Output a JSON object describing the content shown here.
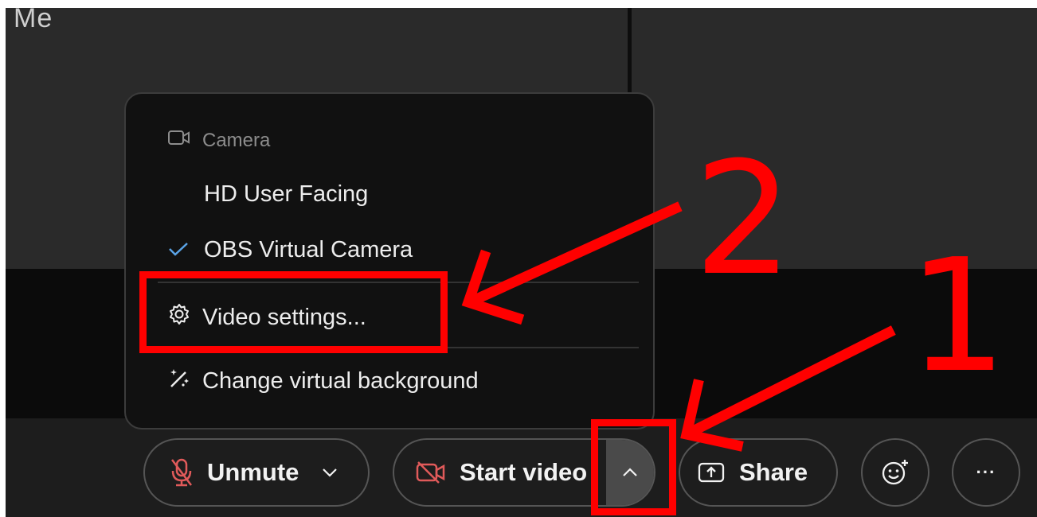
{
  "tile": {
    "name": "Me"
  },
  "menu": {
    "header": "Camera",
    "items": [
      {
        "label": "HD User Facing",
        "selected": false
      },
      {
        "label": "OBS Virtual Camera",
        "selected": true
      },
      {
        "label": "Video settings..."
      },
      {
        "label": "Change virtual background"
      }
    ]
  },
  "toolbar": {
    "unmute_label": "Unmute",
    "video_label": "Start video",
    "share_label": "Share",
    "more_label": "···"
  },
  "annotations": {
    "step1": "1",
    "step2": "2",
    "color": "#ff0000"
  },
  "icons": {
    "camera": "camera-icon",
    "check": "check-icon",
    "gear": "gear-icon",
    "wand": "magic-wand-icon",
    "mic_muted": "muted-mic-icon",
    "video_off": "video-off-icon",
    "share": "share-screen-icon",
    "reactions": "emoji-icon"
  },
  "colors": {
    "muted_red": "#e05a5a",
    "check_blue": "#5aa3e6"
  }
}
